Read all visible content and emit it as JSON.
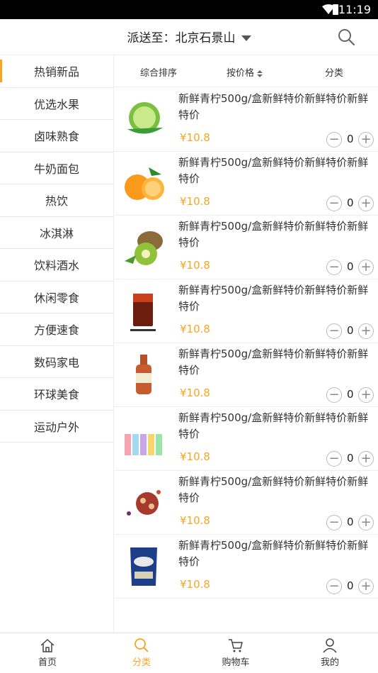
{
  "status": {
    "time": "11:19"
  },
  "header": {
    "title": "派送至：北京石景山"
  },
  "sidebar": {
    "items": [
      {
        "label": "热销新品",
        "active": true
      },
      {
        "label": "优选水果"
      },
      {
        "label": "卤味熟食"
      },
      {
        "label": "牛奶面包"
      },
      {
        "label": "热饮"
      },
      {
        "label": "冰淇淋"
      },
      {
        "label": "饮料酒水"
      },
      {
        "label": "休闲零食"
      },
      {
        "label": "方便速食"
      },
      {
        "label": "数码家电"
      },
      {
        "label": "环球美食"
      },
      {
        "label": "运动户外"
      }
    ]
  },
  "sortbar": {
    "s1": "综合排序",
    "s2": "按价格",
    "s3": "分类"
  },
  "products": [
    {
      "name": "新鲜青柠500g/盒新鲜特价新鲜特价新鲜特价",
      "price": "¥10.8",
      "qty": "0",
      "icon": "lime-icon"
    },
    {
      "name": "新鲜青柠500g/盒新鲜特价新鲜特价新鲜特价",
      "price": "¥10.8",
      "qty": "0",
      "icon": "orange-icon"
    },
    {
      "name": "新鲜青柠500g/盒新鲜特价新鲜特价新鲜特价",
      "price": "¥10.8",
      "qty": "0",
      "icon": "kiwi-icon"
    },
    {
      "name": "新鲜青柠500g/盒新鲜特价新鲜特价新鲜特价",
      "price": "¥10.8",
      "qty": "0",
      "icon": "cola-glass-icon"
    },
    {
      "name": "新鲜青柠500g/盒新鲜特价新鲜特价新鲜特价",
      "price": "¥10.8",
      "qty": "0",
      "icon": "beer-bottle-icon"
    },
    {
      "name": "新鲜青柠500g/盒新鲜特价新鲜特价新鲜特价",
      "price": "¥10.8",
      "qty": "0",
      "icon": "drink-bottles-icon"
    },
    {
      "name": "新鲜青柠500g/盒新鲜特价新鲜特价新鲜特价",
      "price": "¥10.8",
      "qty": "0",
      "icon": "nuts-icon"
    },
    {
      "name": "新鲜青柠500g/盒新鲜特价新鲜特价新鲜特价",
      "price": "¥10.8",
      "qty": "0",
      "icon": "chips-bag-icon"
    }
  ],
  "tabbar": {
    "home": "首页",
    "category": "分类",
    "cart": "购物车",
    "mine": "我的"
  },
  "colors": {
    "accent": "#f6a623"
  }
}
